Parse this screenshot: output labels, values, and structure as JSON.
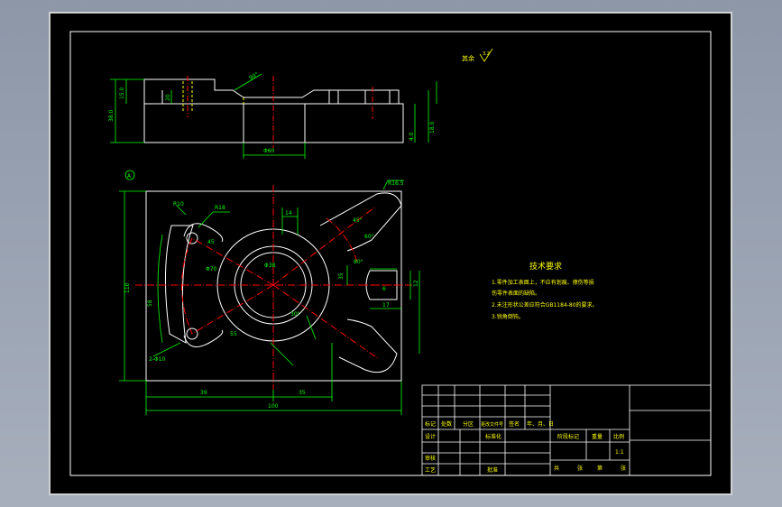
{
  "colors": {
    "background": "#000000",
    "outline": "#ffffff",
    "dimension": "#00ff00",
    "centerline": "#ff0000",
    "hidden": "#ffff00",
    "frame": "#ffffff"
  },
  "surface_finish": {
    "label": "其余",
    "value": "3.2"
  },
  "tech_requirements": {
    "title": "技术要求",
    "lines": [
      "1.零件加工表面上，不应有划痕、擦伤等损",
      "伤零件表面的缺陷。",
      "2.未注形状公差应符合GB1184-80的要求。",
      "3.锐角倒钝。"
    ]
  },
  "front_view_dims": {
    "chamfer": "90°",
    "h1": "15.0",
    "h2": "38.0",
    "mid": "20",
    "bore": "Φ60",
    "r1": "4.0",
    "r2": "18.0"
  },
  "plan_view_dims": {
    "marker": "A",
    "r10": "R10",
    "r18": "R18",
    "r16": "R16.5",
    "w14": "14",
    "a45": "45°",
    "a60": "60°",
    "a80": "80°",
    "a30": "30°",
    "d70": "Φ70",
    "d38": "Φ38",
    "n45": "45",
    "n35": "35",
    "n6": "6",
    "n17": "17",
    "n12": "12",
    "v110": "110",
    "v58": "58",
    "holes": "2-Φ10",
    "h55": "55",
    "bottom_left": "39",
    "bottom_right": "35",
    "total": "100"
  },
  "title_block": {
    "headers": [
      "标记",
      "处数",
      "分区",
      "更改文件号",
      "签名",
      "年、月、日"
    ],
    "design": "设计",
    "standard": "标准化",
    "review": "审核",
    "craft": "工艺",
    "approve": "批准",
    "stage": "阶段标记",
    "weight": "重量",
    "scale": "比例",
    "scale_value": "1:1",
    "sheet_total": "共",
    "sheet_label1": "张",
    "sheet_num": "第",
    "sheet_label2": "张"
  }
}
